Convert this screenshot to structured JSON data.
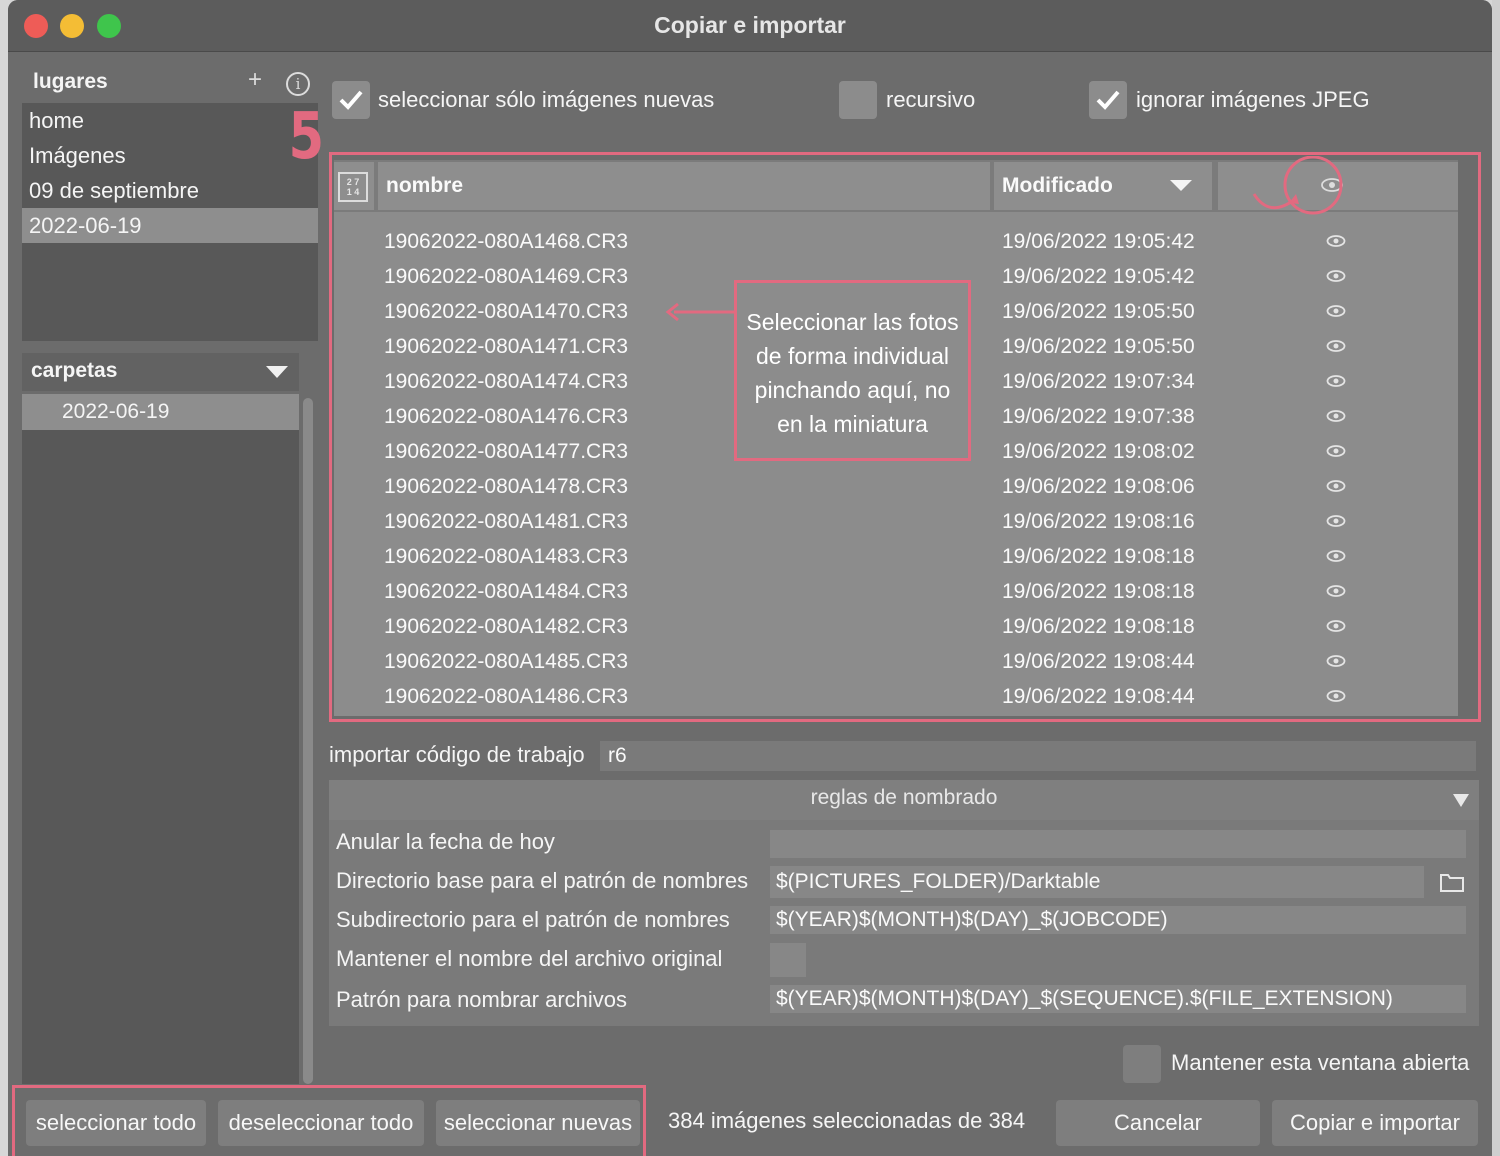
{
  "window": {
    "title": "Copiar e importar"
  },
  "places": {
    "header": "lugares",
    "add_icon": "+",
    "info_icon": "i",
    "step_number": "5",
    "items": [
      {
        "label": "home",
        "selected": false
      },
      {
        "label": "Imágenes",
        "selected": false
      },
      {
        "label": "09 de septiembre",
        "selected": false
      },
      {
        "label": "2022-06-19",
        "selected": true
      }
    ]
  },
  "folders": {
    "header": "carpetas",
    "items": [
      {
        "label": "2022-06-19",
        "selected": true
      }
    ]
  },
  "options": {
    "only_new": {
      "label": "seleccionar sólo imágenes nuevas",
      "checked": true
    },
    "recursive": {
      "label": "recursivo",
      "checked": false
    },
    "ignore_jpeg": {
      "label": "ignorar imágenes JPEG",
      "checked": true
    }
  },
  "table": {
    "thumb_icon": "thumbnail-toggle-icon",
    "columns": {
      "name": "nombre",
      "modified": "Modificado"
    },
    "rows": [
      {
        "name": "19062022-080A1468.CR3",
        "modified": "19/06/2022 19:05:42"
      },
      {
        "name": "19062022-080A1469.CR3",
        "modified": "19/06/2022 19:05:42"
      },
      {
        "name": "19062022-080A1470.CR3",
        "modified": "19/06/2022 19:05:50"
      },
      {
        "name": "19062022-080A1471.CR3",
        "modified": "19/06/2022 19:05:50"
      },
      {
        "name": "19062022-080A1474.CR3",
        "modified": "19/06/2022 19:07:34"
      },
      {
        "name": "19062022-080A1476.CR3",
        "modified": "19/06/2022 19:07:38"
      },
      {
        "name": "19062022-080A1477.CR3",
        "modified": "19/06/2022 19:08:02"
      },
      {
        "name": "19062022-080A1478.CR3",
        "modified": "19/06/2022 19:08:06"
      },
      {
        "name": "19062022-080A1481.CR3",
        "modified": "19/06/2022 19:08:16"
      },
      {
        "name": "19062022-080A1483.CR3",
        "modified": "19/06/2022 19:08:18"
      },
      {
        "name": "19062022-080A1484.CR3",
        "modified": "19/06/2022 19:08:18"
      },
      {
        "name": "19062022-080A1482.CR3",
        "modified": "19/06/2022 19:08:18"
      },
      {
        "name": "19062022-080A1485.CR3",
        "modified": "19/06/2022 19:08:44"
      },
      {
        "name": "19062022-080A1486.CR3",
        "modified": "19/06/2022 19:08:44"
      }
    ]
  },
  "annotation": {
    "lines": [
      "Seleccionar las fotos",
      "de forma individual",
      "pinchando aquí, no",
      "en la miniatura"
    ],
    "color": "#e26a80"
  },
  "jobcode": {
    "label": "importar código de trabajo",
    "value": "r6"
  },
  "naming": {
    "header": "reglas de nombrado",
    "override_date": {
      "label": "Anular la fecha de hoy",
      "value": ""
    },
    "base_dir": {
      "label": "Directorio base para el patrón de nombres",
      "value": "$(PICTURES_FOLDER)/Darktable"
    },
    "sub_dir": {
      "label": "Subdirectorio para el patrón de nombres",
      "value": "$(YEAR)$(MONTH)$(DAY)_$(JOBCODE)"
    },
    "keep_name": {
      "label": "Mantener el nombre del archivo original",
      "checked": false
    },
    "file_pattern": {
      "label": "Patrón para nombrar archivos",
      "value": "$(YEAR)$(MONTH)$(DAY)_$(SEQUENCE).$(FILE_EXTENSION)"
    }
  },
  "keep_open": {
    "label": "Mantener esta ventana abierta",
    "checked": false
  },
  "footer": {
    "select_all": "seleccionar todo",
    "deselect_all": "deseleccionar todo",
    "select_new": "seleccionar nuevas",
    "count": "384 imágenes seleccionadas de 384",
    "cancel": "Cancelar",
    "import": "Copiar e importar"
  },
  "colors": {
    "accent": "#e26a80",
    "window_bg": "#6c6c6c",
    "selected_row": "#8e8e8e"
  }
}
